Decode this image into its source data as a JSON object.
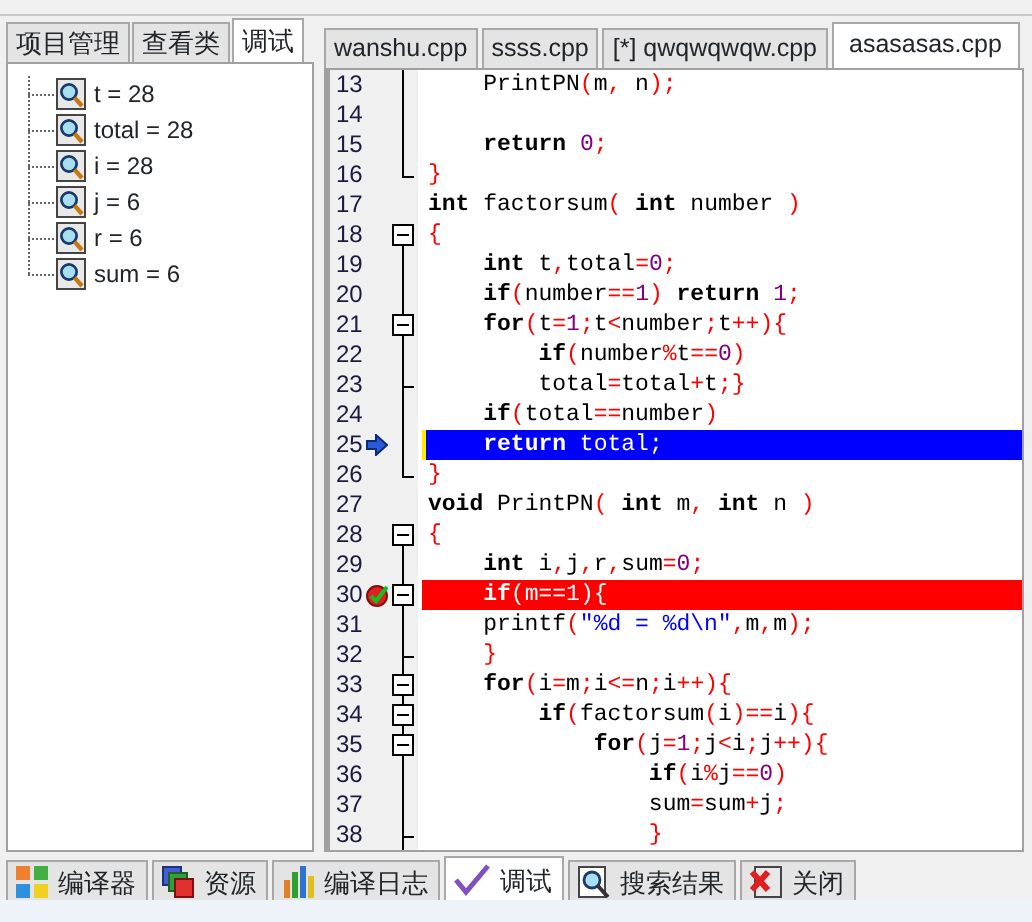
{
  "left_panel": {
    "tabs": [
      {
        "label": "项目管理",
        "selected": false
      },
      {
        "label": "查看类",
        "selected": false
      },
      {
        "label": "调试",
        "selected": true
      }
    ],
    "watches": [
      {
        "label": "t = 28"
      },
      {
        "label": "total = 28"
      },
      {
        "label": "i = 28"
      },
      {
        "label": "j = 6"
      },
      {
        "label": "r = 6"
      },
      {
        "label": "sum = 6"
      }
    ]
  },
  "editor": {
    "tabs": [
      {
        "label": "wanshu.cpp",
        "selected": false
      },
      {
        "label": "ssss.cpp",
        "selected": false
      },
      {
        "label": "[*] qwqwqwqw.cpp",
        "selected": false
      },
      {
        "label": "asasasas.cpp",
        "selected": true
      }
    ],
    "lines": [
      {
        "number": "13",
        "code": "    PrintPN(m, n);",
        "kind": "line",
        "current": false,
        "breakpoint": false
      },
      {
        "number": "14",
        "kind": "line",
        "current": false,
        "breakpoint": false
      },
      {
        "number": "15",
        "code": "    **return** 0;",
        "kind": "line",
        "current": false,
        "breakpoint": false
      },
      {
        "number": "16",
        "code": "}",
        "kind": "end",
        "current": false,
        "breakpoint": false
      },
      {
        "number": "17",
        "code": "**int** factorsum( **int** number )",
        "kind": "plain",
        "current": false,
        "breakpoint": false
      },
      {
        "number": "18",
        "code": "{",
        "kind": "open",
        "current": false,
        "breakpoint": false
      },
      {
        "number": "19",
        "code": "    **int** t,total=0;",
        "kind": "line",
        "current": false,
        "breakpoint": false
      },
      {
        "number": "20",
        "code": "    **if**(number==1) **return** 1;",
        "kind": "line",
        "current": false,
        "breakpoint": false
      },
      {
        "number": "21",
        "code": "    **for**(t=1;t<number;t++){",
        "kind": "branch",
        "current": false,
        "breakpoint": false
      },
      {
        "number": "22",
        "code": "        **if**(number%t==0)",
        "kind": "line",
        "current": false,
        "breakpoint": false
      },
      {
        "number": "23",
        "code": "        total=total+t;}",
        "kind": "mid",
        "current": false,
        "breakpoint": false
      },
      {
        "number": "24",
        "code": "    **if**(total==number)",
        "kind": "line",
        "current": false,
        "breakpoint": false
      },
      {
        "number": "25",
        "code": "    **return** total;",
        "kind": "line",
        "current": true,
        "breakpoint": false
      },
      {
        "number": "26",
        "code": "}",
        "kind": "end",
        "current": false,
        "breakpoint": false
      },
      {
        "number": "27",
        "code": "**void** PrintPN( **int** m, **int** n )",
        "kind": "plain",
        "current": false,
        "breakpoint": false
      },
      {
        "number": "28",
        "code": "{",
        "kind": "open",
        "current": false,
        "breakpoint": false
      },
      {
        "number": "29",
        "code": "    **int** i,j,r,sum=0;",
        "kind": "line",
        "current": false,
        "breakpoint": false
      },
      {
        "number": "30",
        "code": "    **if**(m==1){",
        "kind": "branch",
        "current": false,
        "breakpoint": true
      },
      {
        "number": "31",
        "code": "    printf(\"%d = %d\\n\",m,m);",
        "kind": "line",
        "current": false,
        "breakpoint": false
      },
      {
        "number": "32",
        "code": "    }",
        "kind": "mid",
        "current": false,
        "breakpoint": false
      },
      {
        "number": "33",
        "code": "    **for**(i=m;i<=n;i++){",
        "kind": "branch",
        "current": false,
        "breakpoint": false
      },
      {
        "number": "34",
        "code": "        **if**(factorsum(i)==i){",
        "kind": "branch",
        "current": false,
        "breakpoint": false
      },
      {
        "number": "35",
        "code": "            **for**(j=1;j<i;j++){",
        "kind": "branch",
        "current": false,
        "breakpoint": false
      },
      {
        "number": "36",
        "code": "                **if**(i%j==0)",
        "kind": "line",
        "current": false,
        "breakpoint": false
      },
      {
        "number": "37",
        "code": "                sum=sum+j;",
        "kind": "line",
        "current": false,
        "breakpoint": false
      },
      {
        "number": "38",
        "code": "                }",
        "kind": "mid",
        "current": false,
        "breakpoint": false
      }
    ]
  },
  "bottom_tabs": [
    {
      "label": "编译器",
      "selected": false
    },
    {
      "label": "资源",
      "selected": false
    },
    {
      "label": "编译日志",
      "selected": false
    },
    {
      "label": "调试",
      "selected": true
    },
    {
      "label": "搜索结果",
      "selected": false
    },
    {
      "label": "关闭",
      "selected": false
    }
  ]
}
